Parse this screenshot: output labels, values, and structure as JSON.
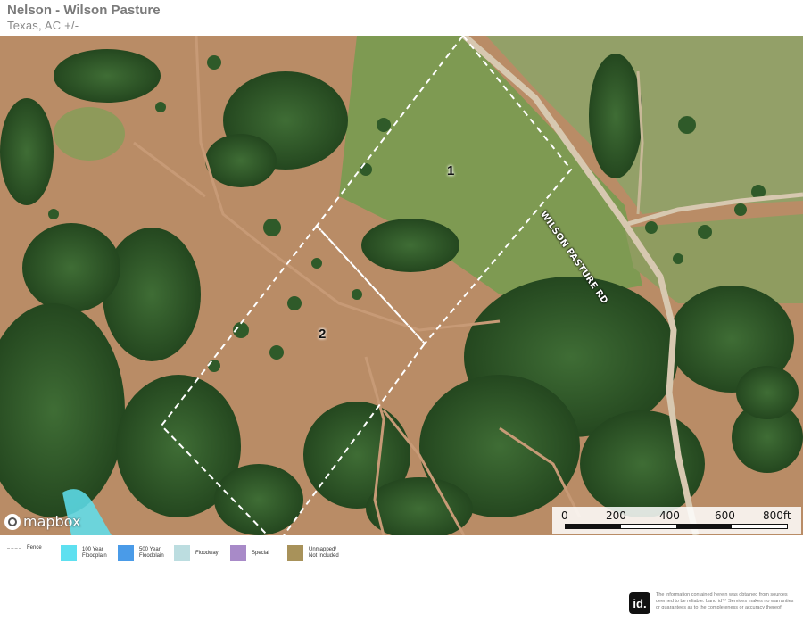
{
  "header": {
    "title": "Nelson - Wilson Pasture",
    "subtitle": "Texas,  AC +/-"
  },
  "map": {
    "parcels": [
      {
        "label": "1"
      },
      {
        "label": "2"
      }
    ],
    "road_label": "WILSON PASTURE RD",
    "attribution": "mapbox",
    "scale": {
      "ticks": [
        "0",
        "200",
        "400",
        "600",
        "800ft"
      ]
    }
  },
  "legend": {
    "items": [
      {
        "label": "Fence",
        "color": "#cfcfcf"
      },
      {
        "label": "100 Year Floodplain",
        "color": "#5ee0f0"
      },
      {
        "label": "500 Year Floodplain",
        "color": "#4a9be8"
      },
      {
        "label": "Floodway",
        "color": "#bcdde0"
      },
      {
        "label": "Special",
        "color": "#a88ac8"
      },
      {
        "label": "Unmapped/ Not Included",
        "color": "#a8925a"
      }
    ]
  },
  "footer": {
    "logo": "id.",
    "disclaimer": "The information contained herein was obtained from sources deemed to be reliable. Land id™ Services makes no warranties or guarantees as to the completeness or accuracy thereof."
  },
  "colors": {
    "pasture": "#7e9a52",
    "bare_ground": "#b88a64",
    "trees": "#2e5a28",
    "water": "#8e9a5a",
    "boundary": "#ffffff"
  }
}
